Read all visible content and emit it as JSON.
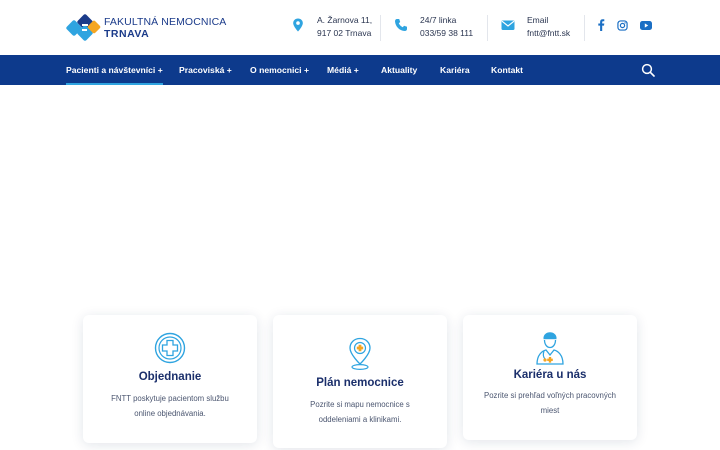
{
  "logo": {
    "line1": "FAKULTNÁ NEMOCNICA",
    "line2": "TRNAVA"
  },
  "contact": {
    "address": {
      "icon": "map-pin-icon",
      "line1": "A. Žarnova 11,",
      "line2": "917 02 Trnava"
    },
    "phone": {
      "icon": "phone-icon",
      "line1": "24/7 linka",
      "line2": "033/59 38 111"
    },
    "email": {
      "icon": "envelope-icon",
      "line1": "Email",
      "line2": "fntt@fntt.sk"
    }
  },
  "social": [
    "facebook-icon",
    "instagram-icon",
    "youtube-icon"
  ],
  "nav": {
    "items": [
      {
        "label": "Pacienti a návštevníci +",
        "active": true
      },
      {
        "label": "Pracoviská +"
      },
      {
        "label": "O nemocnici +"
      },
      {
        "label": "Médiá +"
      },
      {
        "label": "Aktuality"
      },
      {
        "label": "Kariéra"
      },
      {
        "label": "Kontakt"
      }
    ],
    "search_icon": "search-icon"
  },
  "colors": {
    "brand_blue": "#0d3a8c",
    "accent_light_blue": "#2fa4e0",
    "logo_orange": "#f5a623"
  },
  "cards": [
    {
      "icon": "medical-cross-icon",
      "title": "Objednanie",
      "desc_line1": "FNTT poskytuje pacientom službu",
      "desc_line2": "online objednávania."
    },
    {
      "icon": "map-location-icon",
      "title": "Plán nemocnice",
      "desc_line1": "Pozrite si mapu nemocnice s",
      "desc_line2": "oddeleniami a klinikami."
    },
    {
      "icon": "doctor-icon",
      "title": "Kariéra u nás",
      "desc_line1": "Pozrite si prehľad voľných pracovných",
      "desc_line2": "miest"
    }
  ]
}
